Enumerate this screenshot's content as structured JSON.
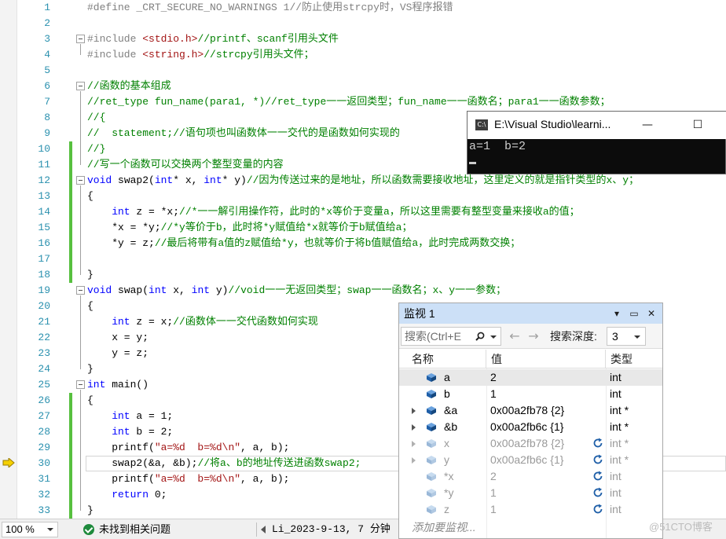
{
  "editor": {
    "lines": [
      {
        "n": "1",
        "segs": [
          {
            "t": "#define ",
            "c": "pp"
          },
          {
            "t": "_CRT_SECURE_NO_WARNINGS",
            "c": "pp"
          },
          {
            "t": " 1//防止使用strcpy时，VS程序报错",
            "c": "pp"
          }
        ]
      },
      {
        "n": "2",
        "segs": []
      },
      {
        "n": "3",
        "fold": true,
        "segs": [
          {
            "t": "#include ",
            "c": "pp"
          },
          {
            "t": "<stdio.h>",
            "c": "st"
          },
          {
            "t": "//printf、scanf引用头文件",
            "c": "cm"
          }
        ]
      },
      {
        "n": "4",
        "segs": [
          {
            "t": "#include ",
            "c": "pp"
          },
          {
            "t": "<string.h>",
            "c": "st"
          },
          {
            "t": "//strcpy引用头文件；",
            "c": "cm"
          }
        ]
      },
      {
        "n": "5",
        "segs": []
      },
      {
        "n": "6",
        "fold": true,
        "segs": [
          {
            "t": "//函数的基本组成",
            "c": "cm"
          }
        ]
      },
      {
        "n": "7",
        "segs": [
          {
            "t": "//ret_type fun_name(para1, *)//ret_type一一返回类型；fun_name一一函数名；para1一一函数参数；",
            "c": "cm"
          }
        ]
      },
      {
        "n": "8",
        "segs": [
          {
            "t": "//{",
            "c": "cm"
          }
        ]
      },
      {
        "n": "9",
        "segs": [
          {
            "t": "//  statement;//语句项也叫函数体一一交代的是函数如何实现的",
            "c": "cm"
          }
        ]
      },
      {
        "n": "10",
        "chg": true,
        "segs": [
          {
            "t": "//}",
            "c": "cm"
          }
        ]
      },
      {
        "n": "11",
        "chg": true,
        "segs": [
          {
            "t": "//写一个函数可以交换两个整型变量的内容",
            "c": "cm"
          }
        ]
      },
      {
        "n": "12",
        "chg": true,
        "fold": true,
        "segs": [
          {
            "t": "void",
            "c": "kw"
          },
          {
            "t": " swap2(",
            "c": ""
          },
          {
            "t": "int",
            "c": "kw"
          },
          {
            "t": "* x, ",
            "c": ""
          },
          {
            "t": "int",
            "c": "kw"
          },
          {
            "t": "* y)",
            "c": ""
          },
          {
            "t": "//因为传送过来的是地址，所以函数需要接收地址，这里定义的就是指针类型的x、y；",
            "c": "cm"
          }
        ]
      },
      {
        "n": "13",
        "chg": true,
        "segs": [
          {
            "t": "{",
            "c": ""
          }
        ]
      },
      {
        "n": "14",
        "chg": true,
        "segs": [
          {
            "t": "    int",
            "c": "kw"
          },
          {
            "t": " z = *x;",
            "c": ""
          },
          {
            "t": "//*一一解引用操作符，此时的*x等价于变量a，所以这里需要有整型变量来接收a的值；",
            "c": "cm"
          }
        ]
      },
      {
        "n": "15",
        "chg": true,
        "segs": [
          {
            "t": "    *x = *y;",
            "c": ""
          },
          {
            "t": "//*y等价于b，此时将*y赋值给*x就等价于b赋值给a；",
            "c": "cm"
          }
        ]
      },
      {
        "n": "16",
        "chg": true,
        "segs": [
          {
            "t": "    *y = z;",
            "c": ""
          },
          {
            "t": "//最后将带有a值的z赋值给*y，也就等价于将b值赋值给a，此时完成两数交换；",
            "c": "cm"
          }
        ]
      },
      {
        "n": "17",
        "chg": true,
        "segs": []
      },
      {
        "n": "18",
        "chg": true,
        "segs": [
          {
            "t": "}",
            "c": ""
          }
        ]
      },
      {
        "n": "19",
        "fold": true,
        "segs": [
          {
            "t": "void",
            "c": "kw"
          },
          {
            "t": " swap(",
            "c": ""
          },
          {
            "t": "int",
            "c": "kw"
          },
          {
            "t": " x, ",
            "c": ""
          },
          {
            "t": "int",
            "c": "kw"
          },
          {
            "t": " y)",
            "c": ""
          },
          {
            "t": "//void一一无返回类型；swap一一函数名；x、y一一参数；",
            "c": "cm"
          }
        ]
      },
      {
        "n": "20",
        "segs": [
          {
            "t": "{",
            "c": ""
          }
        ]
      },
      {
        "n": "21",
        "segs": [
          {
            "t": "    int",
            "c": "kw"
          },
          {
            "t": " z = x;",
            "c": ""
          },
          {
            "t": "//函数体一一交代函数如何实现",
            "c": "cm"
          }
        ]
      },
      {
        "n": "22",
        "segs": [
          {
            "t": "    x = y;",
            "c": ""
          }
        ]
      },
      {
        "n": "23",
        "segs": [
          {
            "t": "    y = z;",
            "c": ""
          }
        ]
      },
      {
        "n": "24",
        "segs": [
          {
            "t": "}",
            "c": ""
          }
        ]
      },
      {
        "n": "25",
        "fold": true,
        "segs": [
          {
            "t": "int",
            "c": "kw"
          },
          {
            "t": " main()",
            "c": ""
          }
        ]
      },
      {
        "n": "26",
        "chg": true,
        "segs": [
          {
            "t": "{",
            "c": ""
          }
        ]
      },
      {
        "n": "27",
        "chg": true,
        "segs": [
          {
            "t": "    int",
            "c": "kw"
          },
          {
            "t": " a = 1;",
            "c": ""
          }
        ]
      },
      {
        "n": "28",
        "chg": true,
        "segs": [
          {
            "t": "    int",
            "c": "kw"
          },
          {
            "t": " b = 2;",
            "c": ""
          }
        ]
      },
      {
        "n": "29",
        "chg": true,
        "segs": [
          {
            "t": "    printf(",
            "c": ""
          },
          {
            "t": "\"a=%d  b=%d\\n\"",
            "c": "st"
          },
          {
            "t": ", a, b);",
            "c": ""
          }
        ]
      },
      {
        "n": "30",
        "chg": true,
        "cur": true,
        "segs": [
          {
            "t": "    swap2(&a, &b);",
            "c": ""
          },
          {
            "t": "//将a、b的地址传送进函数swap2;",
            "c": "cm"
          }
        ]
      },
      {
        "n": "31",
        "chg": true,
        "segs": [
          {
            "t": "    printf(",
            "c": ""
          },
          {
            "t": "\"a=%d  b=%d\\n\"",
            "c": "st"
          },
          {
            "t": ", a, b);",
            "c": ""
          }
        ]
      },
      {
        "n": "32",
        "chg": true,
        "segs": [
          {
            "t": "    return",
            "c": "kw"
          },
          {
            "t": " 0;",
            "c": ""
          }
        ]
      },
      {
        "n": "33",
        "chg": true,
        "segs": [
          {
            "t": "}",
            "c": ""
          }
        ]
      }
    ]
  },
  "statusbar": {
    "zoom": "100 %",
    "issues": "未找到相关问题",
    "author": "Li_2023-9-13, 7 分钟"
  },
  "console": {
    "title": "E:\\Visual Studio\\learni...",
    "output": "a=1  b=2",
    "minimize": "—",
    "maximize": "☐",
    "close": "✕"
  },
  "watch": {
    "title": "监视 1",
    "search_placeholder": "搜索(Ctrl+E",
    "depth_label": "搜索深度:",
    "depth_value": "3",
    "columns": {
      "name": "名称",
      "value": "值",
      "type": "类型"
    },
    "rows": [
      {
        "name": "a",
        "value": "2",
        "type": "int",
        "expand": false,
        "stale": false,
        "sel": true
      },
      {
        "name": "b",
        "value": "1",
        "type": "int",
        "expand": false,
        "stale": false,
        "sel": false
      },
      {
        "name": "&a",
        "value": "0x00a2fb78 {2}",
        "type": "int *",
        "expand": true,
        "stale": false,
        "sel": false
      },
      {
        "name": "&b",
        "value": "0x00a2fb6c {1}",
        "type": "int *",
        "expand": true,
        "stale": false,
        "sel": false
      },
      {
        "name": "x",
        "value": "0x00a2fb78 {2}",
        "type": "int *",
        "expand": true,
        "stale": true,
        "sel": false
      },
      {
        "name": "y",
        "value": "0x00a2fb6c {1}",
        "type": "int *",
        "expand": true,
        "stale": true,
        "sel": false
      },
      {
        "name": "*x",
        "value": "2",
        "type": "int",
        "expand": false,
        "stale": true,
        "sel": false
      },
      {
        "name": "*y",
        "value": "1",
        "type": "int",
        "expand": false,
        "stale": true,
        "sel": false
      },
      {
        "name": "z",
        "value": "1",
        "type": "int",
        "expand": false,
        "stale": true,
        "sel": false
      }
    ],
    "add_placeholder": "添加要监视..."
  },
  "watermark": "@51CTO博客",
  "colors": {
    "accent": "#cce0f7",
    "changed": "#57c03f",
    "keyword": "#0000ff",
    "comment": "#008000",
    "string": "#a31515"
  }
}
